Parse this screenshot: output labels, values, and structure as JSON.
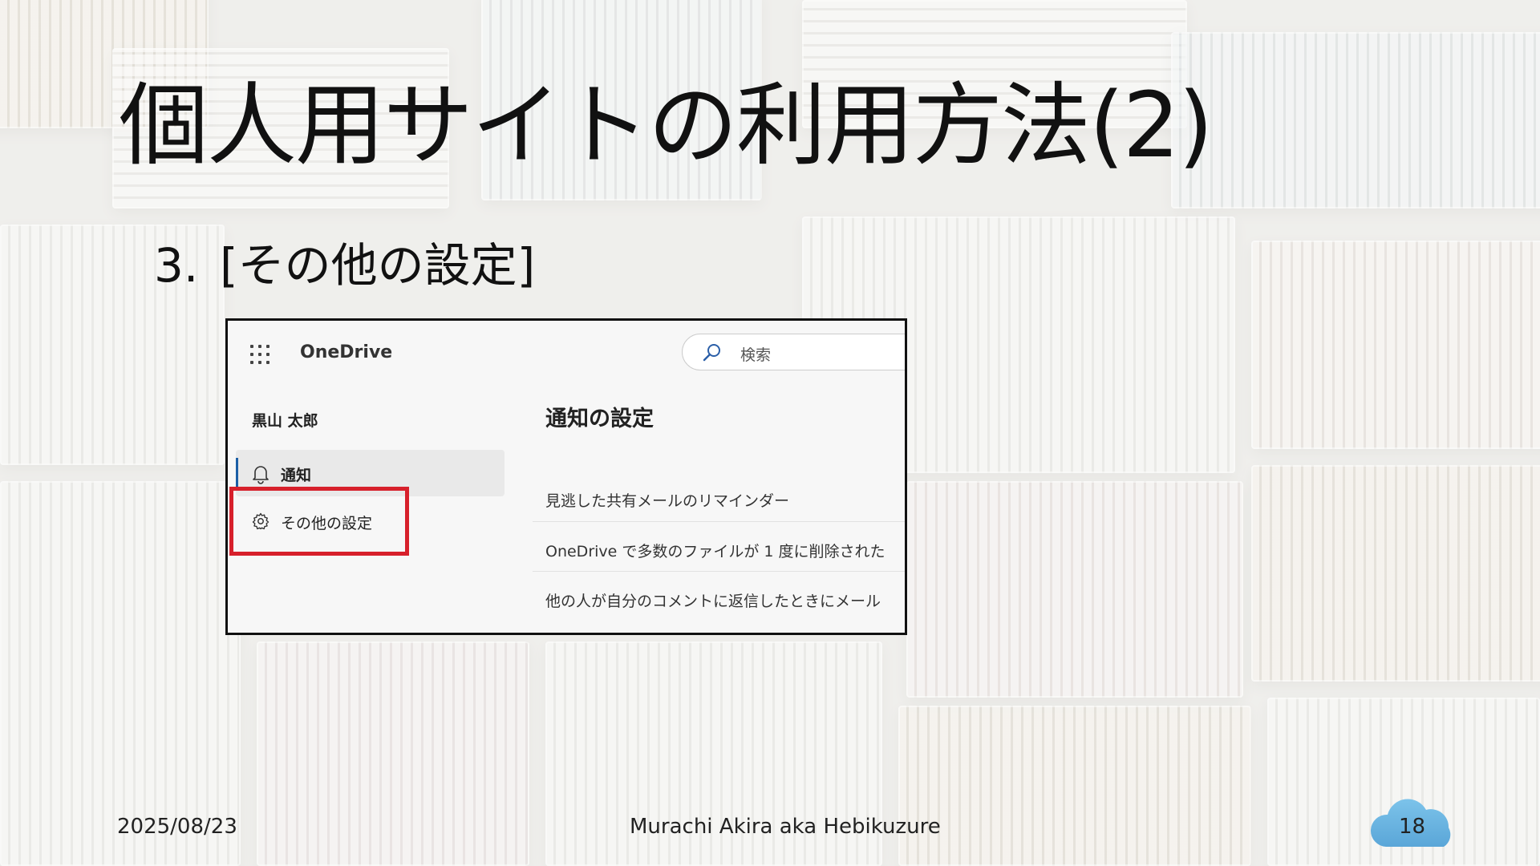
{
  "slide": {
    "title": "個人用サイトの利用方法(2)",
    "step_number": "3.",
    "step_text": "[その他の設定]",
    "footer": {
      "date": "2025/08/23",
      "author": "Murachi Akira aka Hebikuzure",
      "page_number": "18"
    }
  },
  "onedrive": {
    "app_name": "OneDrive",
    "search_placeholder": "検索",
    "user_name": "黒山 太郎",
    "nav": {
      "notifications": "通知",
      "more_settings": "その他の設定"
    },
    "main": {
      "heading": "通知の設定",
      "rows": [
        "見逃した共有メールのリマインダー",
        "OneDrive で多数のファイルが 1 度に削除された",
        "他の人が自分のコメントに返信したときにメール"
      ]
    }
  },
  "colors": {
    "highlight_box": "#d7202b",
    "nav_accent": "#1b5ea6",
    "cloud": "#6fb8e3"
  }
}
